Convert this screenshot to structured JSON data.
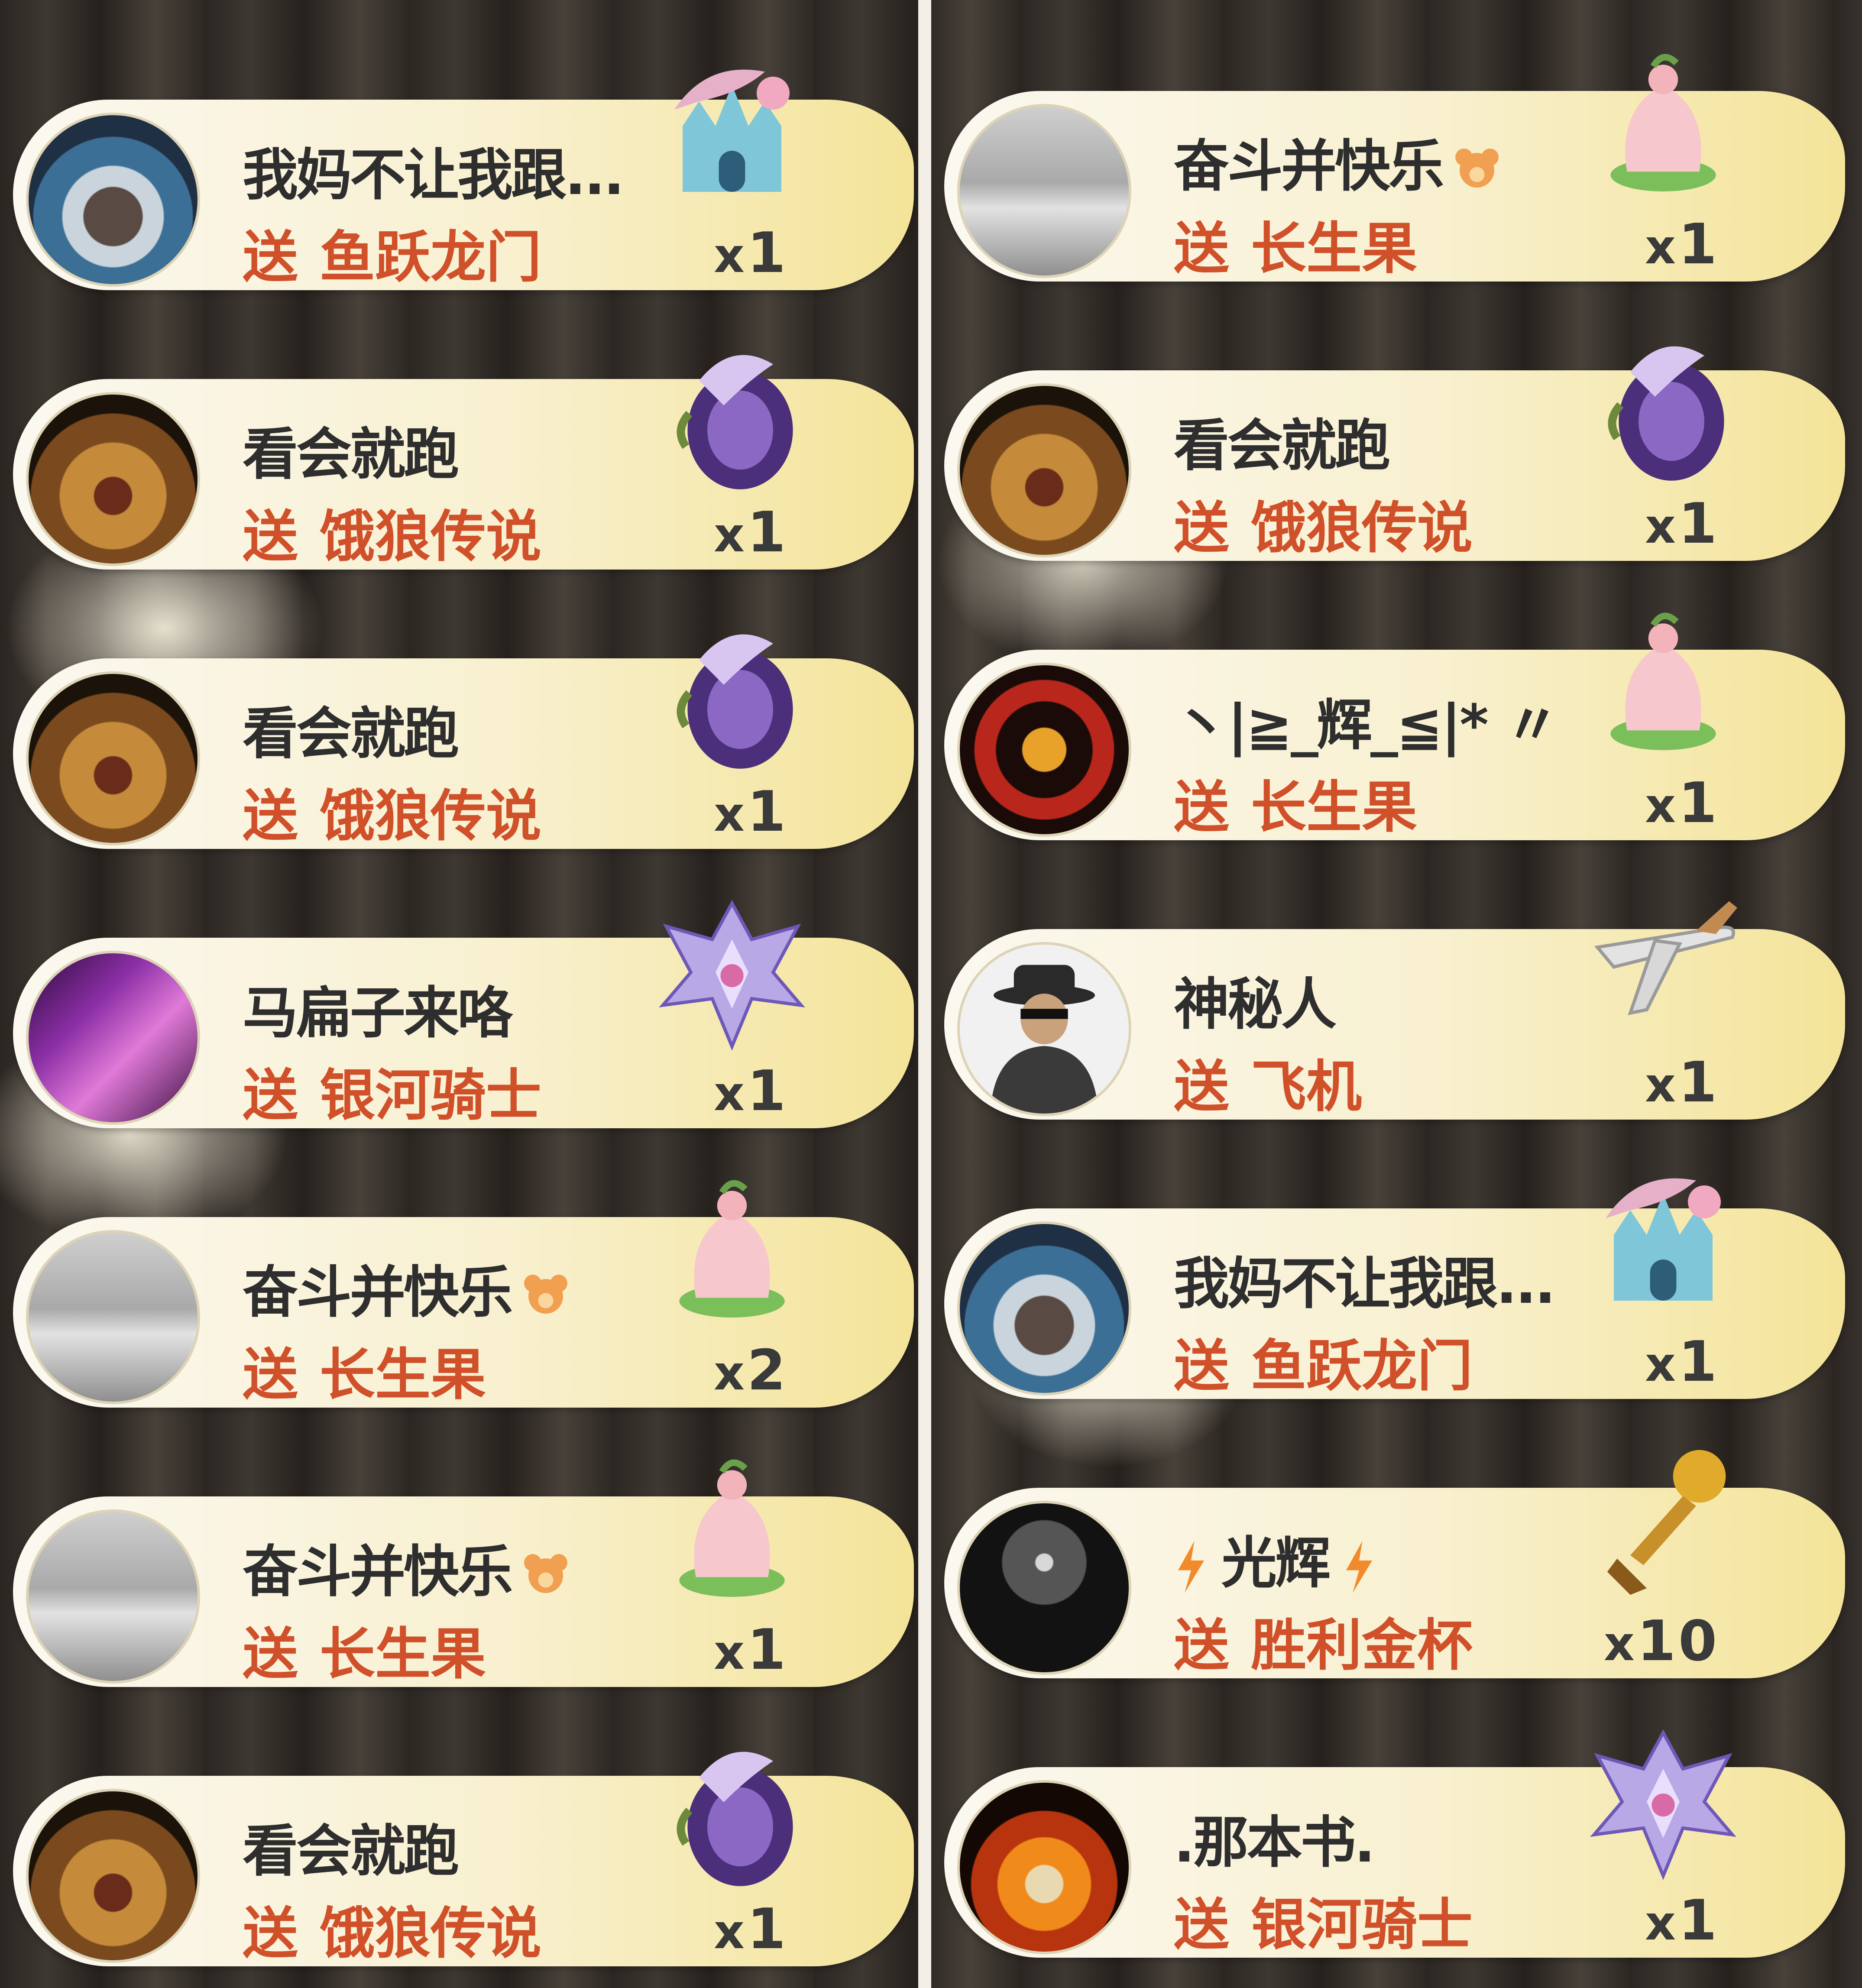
{
  "gift_feed": {
    "left_column": [
      {
        "name": "我妈不让我跟...",
        "verb": "送",
        "gift": "鱼跃龙门",
        "count_prefix": "x",
        "count": "1",
        "avatar_icon": "user-photo-avatar",
        "gift_icon": "dragon-gate-castle-icon"
      },
      {
        "name": "看会就跑",
        "verb": "送",
        "gift": "饿狼传说",
        "count_prefix": "x",
        "count": "1",
        "avatar_icon": "lion-avatar",
        "gift_icon": "wolf-legend-egg-icon"
      },
      {
        "name": "看会就跑",
        "verb": "送",
        "gift": "饿狼传说",
        "count_prefix": "x",
        "count": "1",
        "avatar_icon": "lion-avatar",
        "gift_icon": "wolf-legend-egg-icon"
      },
      {
        "name": "马扁子来咯",
        "verb": "送",
        "gift": "银河骑士",
        "count_prefix": "x",
        "count": "1",
        "avatar_icon": "purple-scene-avatar",
        "gift_icon": "galaxy-knight-emblem-icon"
      },
      {
        "name": "奋斗并快乐",
        "verb": "送",
        "gift": "长生果",
        "count_prefix": "x",
        "count": "2",
        "avatar_icon": "grey-cloud-avatar",
        "gift_icon": "longevity-fruit-icon",
        "badge": "bear-badge-icon"
      },
      {
        "name": "奋斗并快乐",
        "verb": "送",
        "gift": "长生果",
        "count_prefix": "x",
        "count": "1",
        "avatar_icon": "grey-cloud-avatar",
        "gift_icon": "longevity-fruit-icon",
        "badge": "bear-badge-icon"
      },
      {
        "name": "看会就跑",
        "verb": "送",
        "gift": "饿狼传说",
        "count_prefix": "x",
        "count": "1",
        "avatar_icon": "lion-avatar",
        "gift_icon": "wolf-legend-egg-icon"
      }
    ],
    "right_column": [
      {
        "name": "奋斗并快乐",
        "verb": "送",
        "gift": "长生果",
        "count_prefix": "x",
        "count": "1",
        "avatar_icon": "grey-cloud-avatar",
        "gift_icon": "longevity-fruit-icon",
        "badge": "bear-badge-icon"
      },
      {
        "name": "看会就跑",
        "verb": "送",
        "gift": "饿狼传说",
        "count_prefix": "x",
        "count": "1",
        "avatar_icon": "lion-avatar",
        "gift_icon": "wolf-legend-egg-icon"
      },
      {
        "name": "丶|≧_辉_≦|* 〃",
        "verb": "送",
        "gift": "长生果",
        "count_prefix": "x",
        "count": "1",
        "avatar_icon": "dragon-emblem-avatar",
        "gift_icon": "longevity-fruit-icon"
      },
      {
        "name": "神秘人",
        "verb": "送",
        "gift": "飞机",
        "count_prefix": "x",
        "count": "1",
        "avatar_icon": "mystery-man-avatar",
        "gift_icon": "airplane-icon"
      },
      {
        "name": "我妈不让我跟...",
        "verb": "送",
        "gift": "鱼跃龙门",
        "count_prefix": "x",
        "count": "1",
        "avatar_icon": "user-photo-avatar",
        "gift_icon": "dragon-gate-castle-icon"
      },
      {
        "name": "光辉",
        "verb": "送",
        "gift": "胜利金杯",
        "count_prefix": "x",
        "count": "10",
        "avatar_icon": "dark-logo-avatar",
        "gift_icon": "golden-trophy-icon",
        "decoration": "lightning-bolt-icon"
      },
      {
        "name": ".那本书.",
        "verb": "送",
        "gift": "银河骑士",
        "count_prefix": "x",
        "count": "1",
        "avatar_icon": "flaming-skull-avatar",
        "gift_icon": "galaxy-knight-emblem-icon"
      }
    ]
  },
  "colors": {
    "gift_text": "#d0502a",
    "name_text": "#2e2e2e",
    "banner_light": "#fbf8f0",
    "banner_gold": "#f4e499"
  }
}
